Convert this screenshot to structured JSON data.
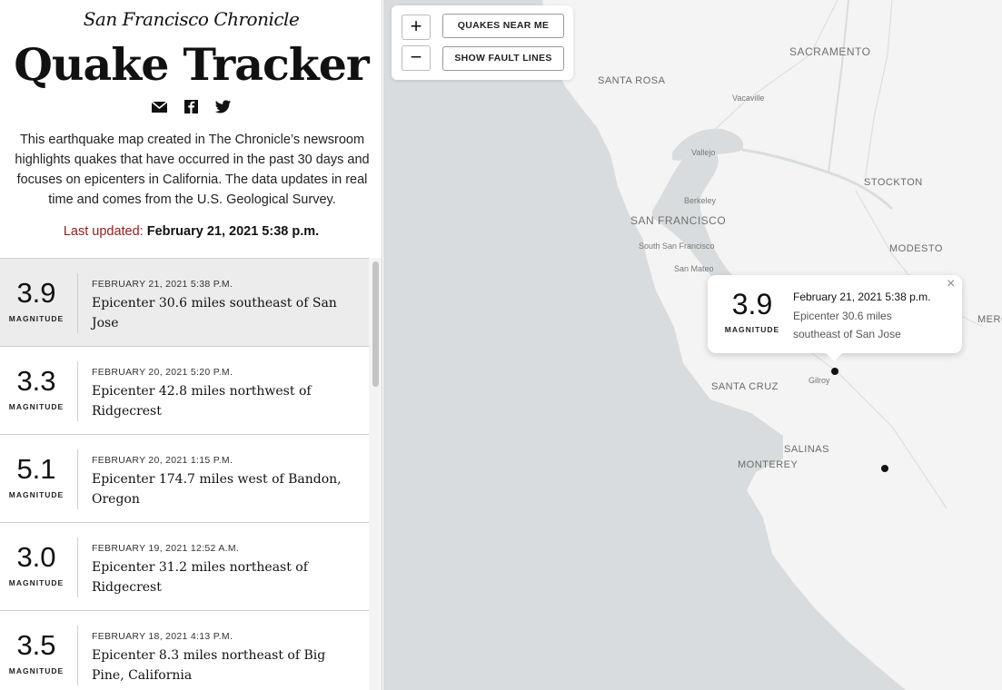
{
  "header": {
    "masthead": "San Francisco Chronicle",
    "title": "Quake Tracker",
    "share_icons": [
      "email-icon",
      "facebook-icon",
      "twitter-icon"
    ],
    "intro": "This earthquake map created in The Chronicle’s newsroom highlights quakes that have occurred in the past 30 days and focuses on epicenters in California. The data updates in real time and comes from the U.S. Geological Survey.",
    "last_updated_label": "Last updated:",
    "last_updated_value": "February 21, 2021 5:38 p.m."
  },
  "quakes": [
    {
      "magnitude": "3.9",
      "magnitude_label": "MAGNITUDE",
      "date": "FEBRUARY 21, 2021 5:38 P.M.",
      "description": "Epicenter 30.6 miles southeast of San Jose",
      "selected": true
    },
    {
      "magnitude": "3.3",
      "magnitude_label": "MAGNITUDE",
      "date": "FEBRUARY 20, 2021 5:20 P.M.",
      "description": "Epicenter 42.8 miles northwest of Ridgecrest",
      "selected": false
    },
    {
      "magnitude": "5.1",
      "magnitude_label": "MAGNITUDE",
      "date": "FEBRUARY 20, 2021 1:15 P.M.",
      "description": "Epicenter 174.7 miles west of Bandon, Oregon",
      "selected": false
    },
    {
      "magnitude": "3.0",
      "magnitude_label": "MAGNITUDE",
      "date": "FEBRUARY 19, 2021 12:52 A.M.",
      "description": "Epicenter 31.2 miles northeast of Ridgecrest",
      "selected": false
    },
    {
      "magnitude": "3.5",
      "magnitude_label": "MAGNITUDE",
      "date": "FEBRUARY 18, 2021 4:13 P.M.",
      "description": "Epicenter 8.3 miles northeast of Big Pine, California",
      "selected": false
    }
  ],
  "map": {
    "controls": {
      "zoom_in": "+",
      "zoom_out": "−",
      "quakes_near_me": "QUAKES NEAR ME",
      "show_fault_lines": "SHOW FAULT LINES"
    },
    "labels": {
      "sacramento": "SACRAMENTO",
      "santa_rosa": "SANTA ROSA",
      "vacaville": "Vacaville",
      "vallejo": "Vallejo",
      "berkeley": "Berkeley",
      "stockton": "STOCKTON",
      "san_francisco": "SAN FRANCISCO",
      "south_san_francisco": "South San Francisco",
      "modesto": "MODESTO",
      "san_mateo": "San Mateo",
      "merced": "MERC",
      "gilroy": "Gilroy",
      "santa_cruz": "SANTA CRUZ",
      "salinas": "SALINAS",
      "monterey": "MONTEREY"
    },
    "popup": {
      "magnitude": "3.9",
      "magnitude_label": "MAGNITUDE",
      "date": "February 21, 2021 5:38 p.m.",
      "description": "Epicenter 30.6 miles southeast of San Jose",
      "close": "×"
    }
  },
  "colors": {
    "water": "#d9dcde",
    "land": "#f4f4f4",
    "accent_red": "#9b1a1a",
    "selected_row": "#ececec",
    "marker": "#111111"
  }
}
